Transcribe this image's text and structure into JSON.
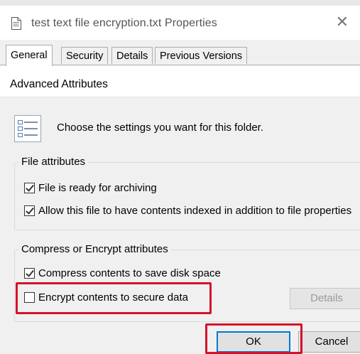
{
  "window": {
    "title": "test text file encryption.txt Properties",
    "close_glyph": "✕",
    "icon": "text-file-icon"
  },
  "tabs": [
    {
      "label": "General",
      "active": true
    },
    {
      "label": "Security",
      "active": false
    },
    {
      "label": "Details",
      "active": false
    },
    {
      "label": "Previous Versions",
      "active": false
    }
  ],
  "dialog": {
    "title": "Advanced Attributes",
    "info_icon": "settings-list-icon",
    "description": "Choose the settings you want for this folder."
  },
  "file_attributes": {
    "label": "File attributes",
    "archive": {
      "label": "File is ready for archiving",
      "checked": true
    },
    "index": {
      "label": "Allow this file to have contents indexed in addition to file properties",
      "checked": true
    }
  },
  "compress_encrypt": {
    "label": "Compress or Encrypt attributes",
    "compress": {
      "label": "Compress contents to save disk space",
      "checked": true
    },
    "encrypt": {
      "label": "Encrypt contents to secure data",
      "checked": false
    },
    "details_label": "Details"
  },
  "buttons": {
    "ok_label": "OK",
    "cancel_label": "Cancel"
  },
  "colors": {
    "highlight": "#d3132a",
    "focus": "#0078d7",
    "background": "#f0f0f0"
  }
}
